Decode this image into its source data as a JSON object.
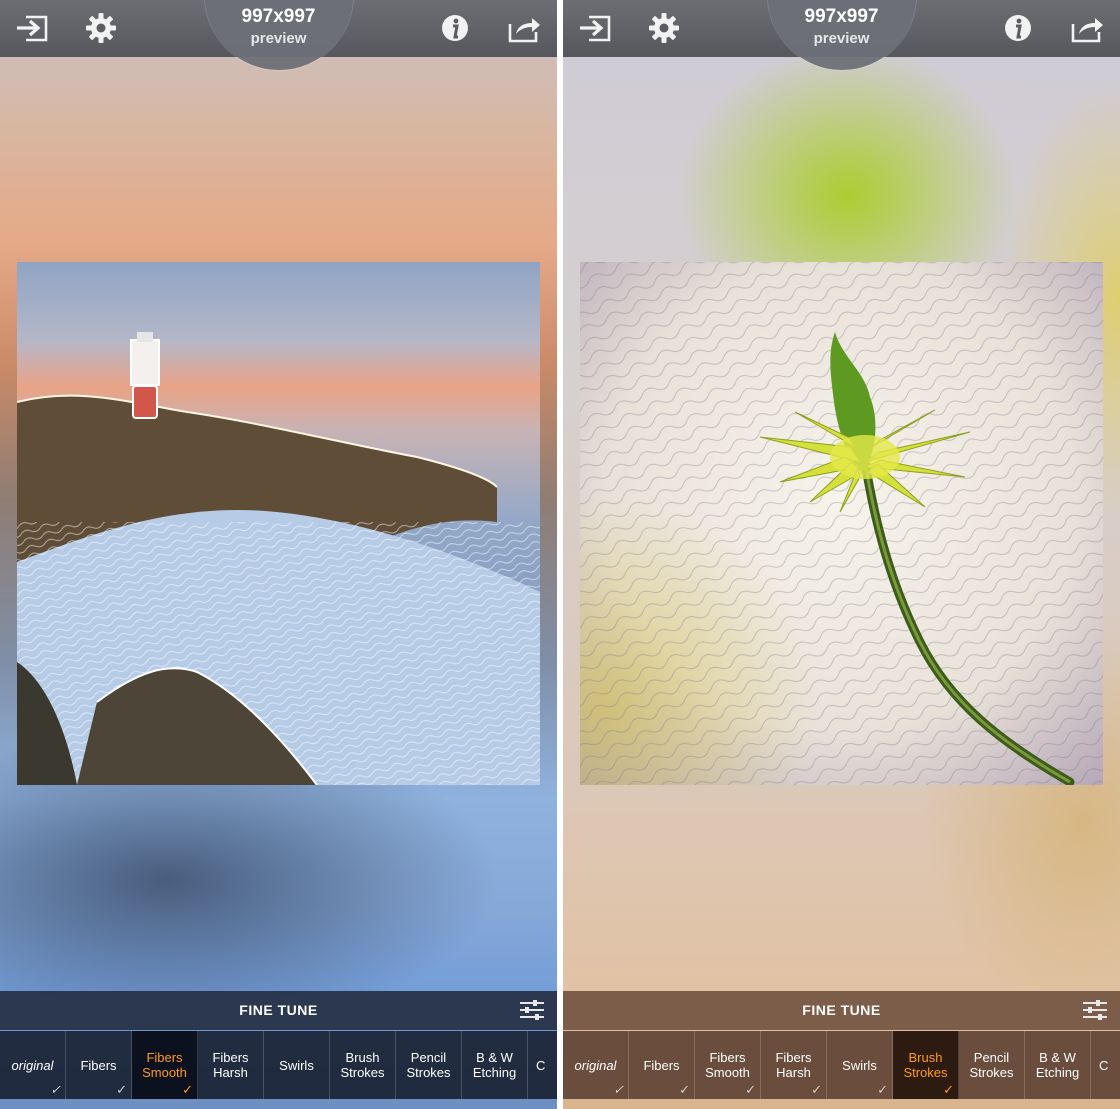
{
  "left": {
    "top_bar": {
      "size": "997x997",
      "size_sub": "preview"
    },
    "fine_tune": "FINE TUNE",
    "filters": [
      {
        "label": "original",
        "checked": true,
        "selected": false
      },
      {
        "label": "Fibers",
        "checked": true,
        "selected": false
      },
      {
        "label": "Fibers\nSmooth",
        "checked": true,
        "selected": true
      },
      {
        "label": "Fibers\nHarsh",
        "checked": false,
        "selected": false
      },
      {
        "label": "Swirls",
        "checked": false,
        "selected": false
      },
      {
        "label": "Brush\nStrokes",
        "checked": false,
        "selected": false
      },
      {
        "label": "Pencil\nStrokes",
        "checked": false,
        "selected": false
      },
      {
        "label": "B & W\nEtching",
        "checked": false,
        "selected": false
      },
      {
        "label": "C",
        "checked": false,
        "selected": false
      }
    ]
  },
  "right": {
    "top_bar": {
      "size": "997x997",
      "size_sub": "preview"
    },
    "fine_tune": "FINE TUNE",
    "filters": [
      {
        "label": "original",
        "checked": true,
        "selected": false
      },
      {
        "label": "Fibers",
        "checked": true,
        "selected": false
      },
      {
        "label": "Fibers\nSmooth",
        "checked": true,
        "selected": false
      },
      {
        "label": "Fibers\nHarsh",
        "checked": true,
        "selected": false
      },
      {
        "label": "Swirls",
        "checked": true,
        "selected": false
      },
      {
        "label": "Brush\nStrokes",
        "checked": true,
        "selected": true
      },
      {
        "label": "Pencil\nStrokes",
        "checked": false,
        "selected": false
      },
      {
        "label": "B & W\nEtching",
        "checked": false,
        "selected": false
      },
      {
        "label": "C",
        "checked": false,
        "selected": false
      }
    ]
  },
  "icons": {
    "import": "import-icon",
    "settings": "gear-icon",
    "info": "info-icon",
    "share": "share-icon",
    "fine_tune": "sliders-icon",
    "check": "checkmark-icon"
  },
  "colors": {
    "selected_text": "#ff9a1a"
  }
}
